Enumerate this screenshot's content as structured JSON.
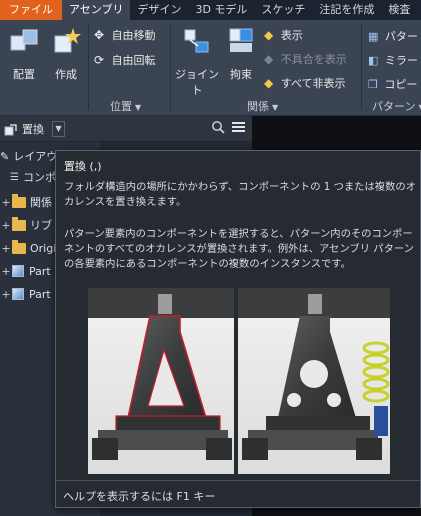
{
  "tabs": [
    {
      "label": "ファイル",
      "kind": "file"
    },
    {
      "label": "アセンブリ",
      "kind": "active"
    },
    {
      "label": "デザイン",
      "kind": ""
    },
    {
      "label": "3D モデル",
      "kind": ""
    },
    {
      "label": "スケッチ",
      "kind": ""
    },
    {
      "label": "注記を作成",
      "kind": ""
    },
    {
      "label": "検査",
      "kind": ""
    }
  ],
  "ribbon": {
    "place": "配置",
    "create": "作成",
    "free_move": "自由移動",
    "free_rotate": "自由回転",
    "position_panel": "位置",
    "joint": "ジョイント",
    "constrain": "拘束",
    "show": "表示",
    "show_sick": "不具合を表示",
    "hide_all": "すべて非表示",
    "relations_panel": "関係",
    "pattern": "パター",
    "mirror": "ミラー",
    "copy": "コピー",
    "pattern_panel": "パターン"
  },
  "browser": {
    "replace_label": "置換",
    "rows": [
      {
        "label": "レイアウトビュー",
        "icon": "edit-icon",
        "plus": ""
      },
      {
        "label": "コンポーネント",
        "icon": "",
        "plus": ""
      },
      {
        "label": "関係",
        "icon": "folder-icon",
        "plus": "+"
      },
      {
        "label": "リブ",
        "icon": "folder-icon",
        "plus": "+"
      },
      {
        "label": "Origin",
        "icon": "folder-icon",
        "plus": "+"
      },
      {
        "label": "Part",
        "icon": "part-icon",
        "plus": "+"
      },
      {
        "label": "Part",
        "icon": "part-icon",
        "plus": "+"
      }
    ]
  },
  "tooltip": {
    "title": "置換 (,)",
    "para1": "フォルダ構造内の場所にかかわらず、コンポーネントの 1 つまたは複数のオカレンスを置き換えます。",
    "para2": "パターン要素内のコンポーネントを選択すると、パターン内のそのコンポーネントのすべてのオカレンスが置換されます。例外は、アセンブリ パターンの各要素内にあるコンポーネントの複数のインスタンスです。",
    "footer": "ヘルプを表示するには F1 キー"
  },
  "colors": {
    "file_tab": "#e0621c",
    "ribbon": "#3b4453",
    "highlight": "#c0202a"
  }
}
